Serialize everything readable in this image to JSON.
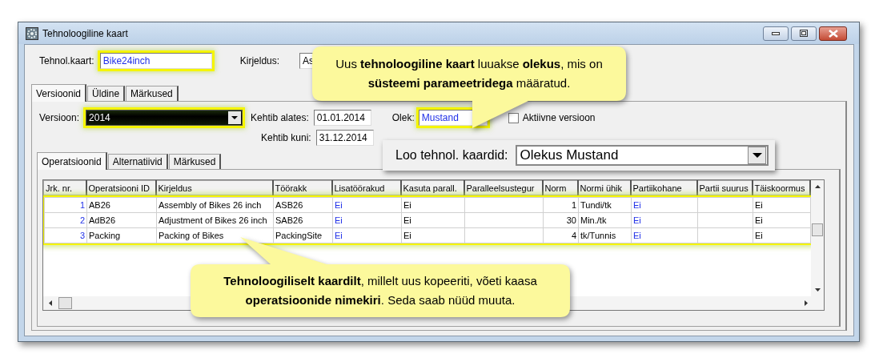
{
  "window": {
    "title": "Tehnoloogiline kaart"
  },
  "header": {
    "card": {
      "label": "Tehnol.kaart:",
      "value": "Bike24inch",
      "highlighted": true
    },
    "description": {
      "label": "Kirjeldus:",
      "value": "As"
    }
  },
  "tabs": [
    {
      "label": "Versioonid",
      "selected": true
    },
    {
      "label": "Üldine",
      "selected": false
    },
    {
      "label": "Märkused",
      "selected": false
    }
  ],
  "version": {
    "version": {
      "label": "Versioon:",
      "value": "2014",
      "highlighted": true
    },
    "valid_from": {
      "label": "Kehtib alates:",
      "value": "01.01.2014"
    },
    "valid_to": {
      "label": "Kehtib kuni:",
      "value": "31.12.2014"
    },
    "status": {
      "label": "Olek:",
      "value": "Mustand",
      "highlighted": true
    },
    "active": {
      "label": "Aktiivne versioon",
      "checked": false
    }
  },
  "sub_tabs": [
    {
      "label": "Operatsioonid",
      "selected": true
    },
    {
      "label": "Alternatiivid",
      "selected": false
    },
    {
      "label": "Märkused",
      "selected": false
    }
  ],
  "operations": {
    "highlighted": true,
    "columns": [
      {
        "title": "Jrk. nr.",
        "kind": "index"
      },
      {
        "title": "Operatsiooni ID",
        "kind": "text"
      },
      {
        "title": "Kirjeldus",
        "kind": "text"
      },
      {
        "title": "Töörakk",
        "kind": "text"
      },
      {
        "title": "Lisatöörakud",
        "kind": "link"
      },
      {
        "title": "Kasuta parall.",
        "kind": "text"
      },
      {
        "title": "Paralleelsustegur",
        "kind": "text"
      },
      {
        "title": "Norm",
        "kind": "number"
      },
      {
        "title": "Normi ühik",
        "kind": "text"
      },
      {
        "title": "Partiikohane",
        "kind": "link"
      },
      {
        "title": "Partii suurus",
        "kind": "text"
      },
      {
        "title": "Täiskoormus",
        "kind": "text"
      }
    ],
    "rows": [
      [
        "1",
        "AB26",
        "Assembly of Bikes 26 inch",
        "ASB26",
        "Ei",
        "Ei",
        "",
        "1",
        "Tundi/tk",
        "Ei",
        "",
        "Ei"
      ],
      [
        "2",
        "AdB26",
        "Adjustment of Bikes 26 inch",
        "SAB26",
        "Ei",
        "Ei",
        "",
        "30",
        "Min./tk",
        "Ei",
        "",
        "Ei"
      ],
      [
        "3",
        "Packing",
        "Packing of Bikes",
        "PackingSite",
        "Ei",
        "Ei",
        "",
        "4",
        "tk/Tunnis",
        "Ei",
        "",
        "Ei"
      ]
    ]
  },
  "callouts": [
    {
      "text": "Uus **tehnoloogiline kaart** luuakse **olekus**, mis on **süsteemi parameetridega** määratud."
    },
    {
      "text": "**Tehnoloogiliselt kaardilt**, millelt uus kopeeriti, võeti kaasa **operatsioonide nimekiri**. Seda saab nüüd muuta."
    }
  ],
  "overlay": {
    "label": "Loo tehnol. kaardid:",
    "value": "Olekus Mustand"
  }
}
